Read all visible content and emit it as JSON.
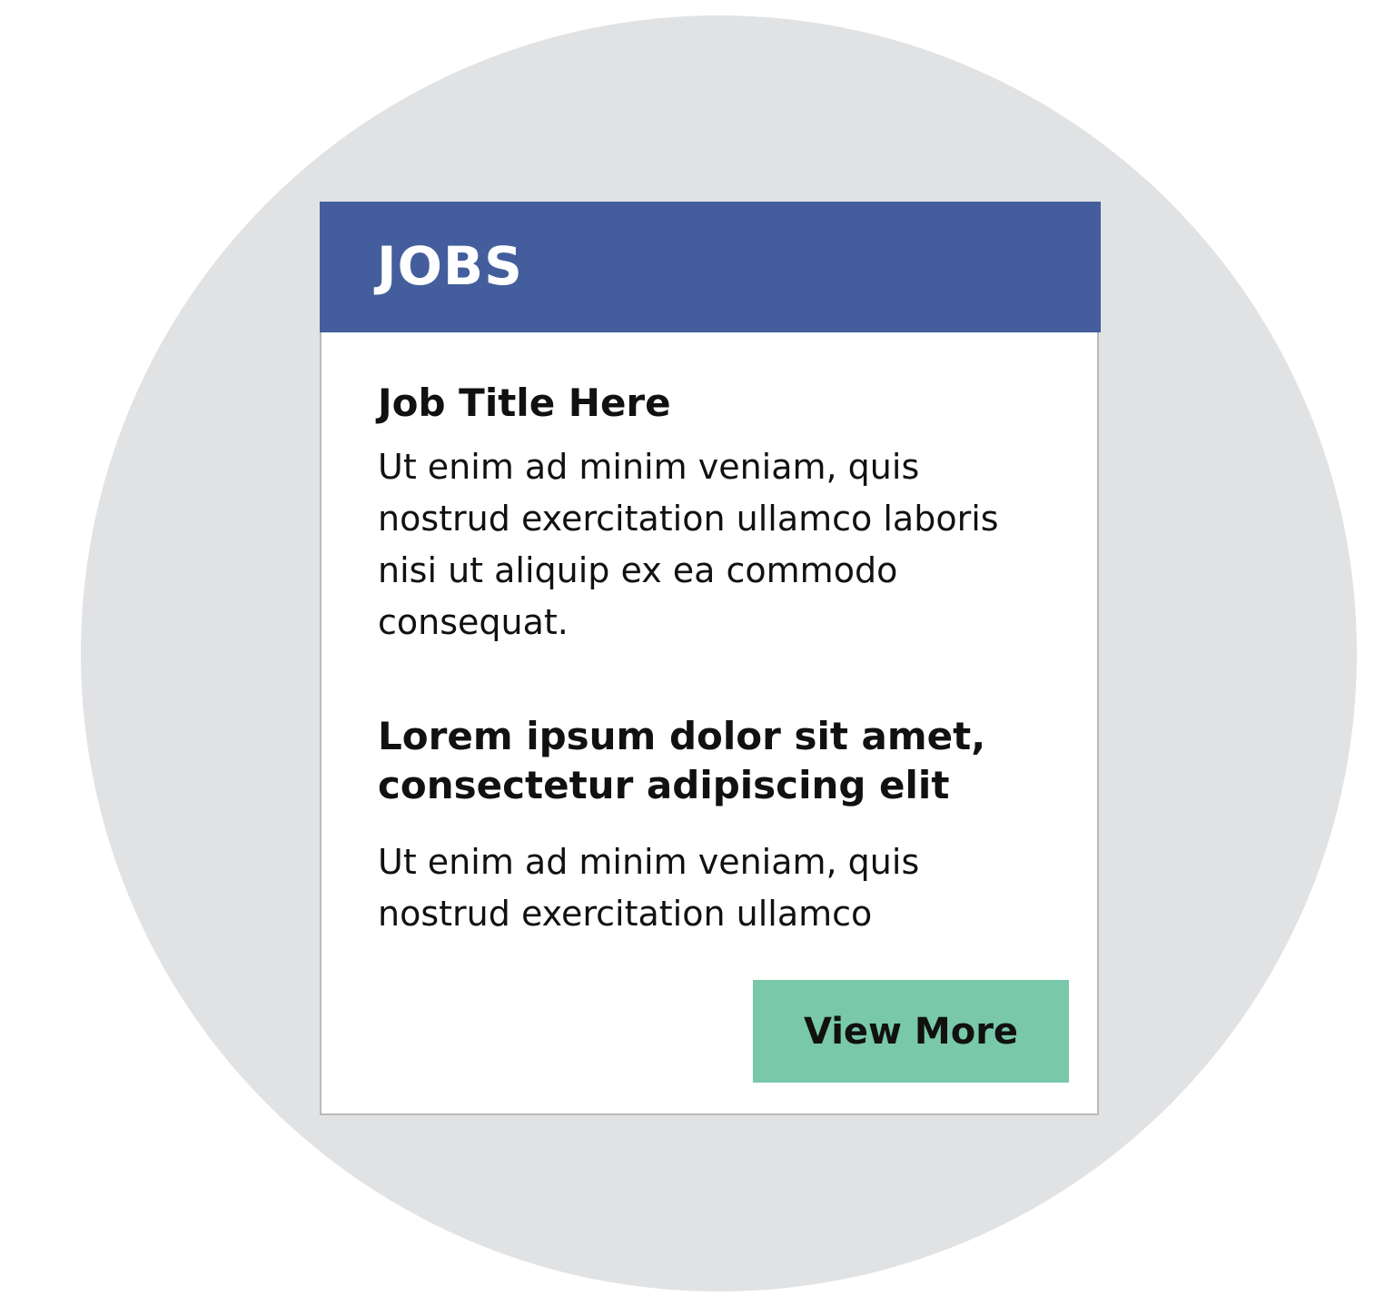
{
  "card": {
    "title": "JOBS",
    "job": {
      "title": "Job Title Here",
      "description": "Ut enim ad minim veniam, quis nostrud exercitation ullamco laboris nisi ut aliquip ex ea commodo consequat."
    },
    "section": {
      "heading": "Lorem ipsum dolor sit amet, consectetur adipiscing elit",
      "description": "Ut enim ad minim veniam, quis nostrud exercitation ullamco"
    },
    "button_label": "View More"
  },
  "colors": {
    "header": "#445e9d",
    "button": "#78c8a9",
    "background_circle": "#e1e2e4"
  }
}
